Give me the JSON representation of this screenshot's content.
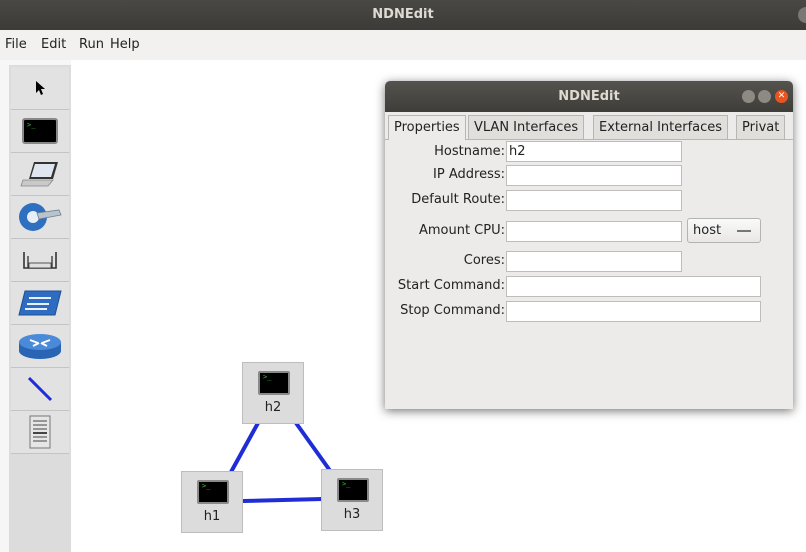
{
  "window": {
    "title": "NDNEdit"
  },
  "menu": [
    "File",
    "Edit",
    "Run",
    "Help"
  ],
  "toolbar": {
    "tools": [
      "select-tool",
      "host-tool",
      "laptop-tool",
      "controller-tool",
      "access-point-tool",
      "switch-tool",
      "router-tool",
      "link-tool",
      "server-tool"
    ]
  },
  "canvas": {
    "nodes": [
      {
        "label": "h2"
      },
      {
        "label": "h1"
      },
      {
        "label": "h3"
      }
    ],
    "terminal_glyph": ">_",
    "link_color": "#1f2dd6"
  },
  "dialog": {
    "title": "NDNEdit",
    "tabs": [
      "Properties",
      "VLAN Interfaces",
      "External Interfaces",
      "Privat"
    ],
    "fields": {
      "hostname": {
        "label": "Hostname:",
        "value": "h2"
      },
      "ip": {
        "label": "IP Address:",
        "value": ""
      },
      "route": {
        "label": "Default Route:",
        "value": ""
      },
      "cpu": {
        "label": "Amount CPU:",
        "value": "",
        "select": "host"
      },
      "cores": {
        "label": "Cores:",
        "value": ""
      },
      "start": {
        "label": "Start Command:",
        "value": ""
      },
      "stop": {
        "label": "Stop Command:",
        "value": ""
      }
    }
  }
}
